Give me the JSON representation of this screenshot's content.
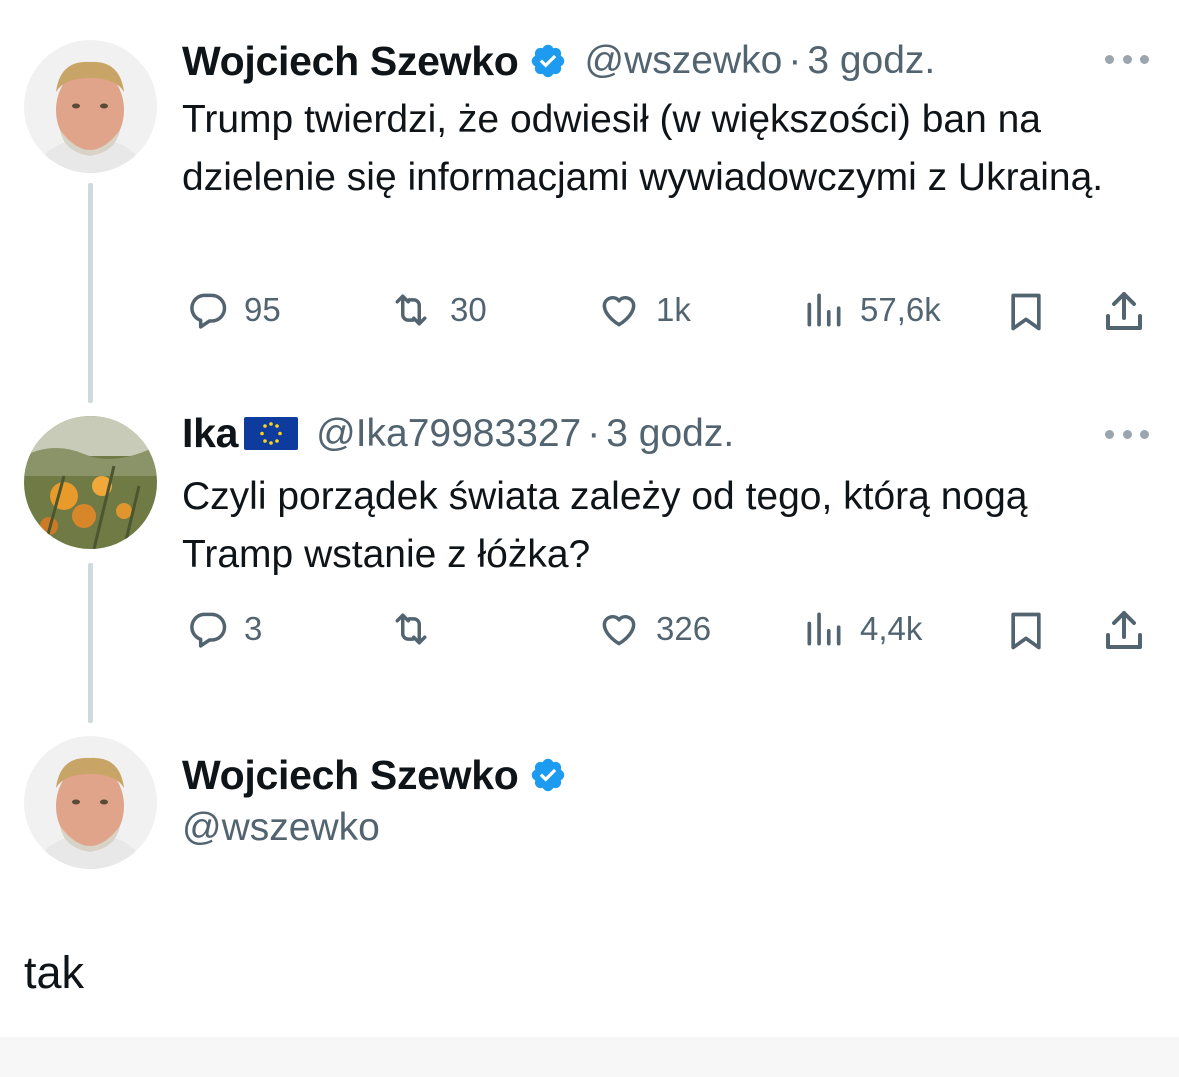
{
  "tweet1": {
    "name": "Wojciech Szewko",
    "handle": "@wszewko",
    "separator": "·",
    "time": "3 godz.",
    "text": "Trump twierdzi, że odwiesił (w większości) ban na dzielenie się informacjami wywiadowczymi z Ukrainą.",
    "replies": "95",
    "retweets": "30",
    "likes": "1k",
    "views": "57,6k"
  },
  "tweet2": {
    "name": "Ika",
    "flag_icon": "eu-flag-icon",
    "handle": "@Ika79983327",
    "separator": "·",
    "time": "3 godz.",
    "text": "Czyli porządek świata zależy od tego, którą nogą Tramp wstanie z łóżka?",
    "replies": "3",
    "retweets": "",
    "likes": "326",
    "views": "4,4k"
  },
  "composer": {
    "name": "Wojciech Szewko",
    "handle": "@wszewko",
    "reply_text": "tak"
  },
  "colors": {
    "verified": "#1d9bf0",
    "muted": "#536471",
    "thread_line": "#cfd9de"
  }
}
